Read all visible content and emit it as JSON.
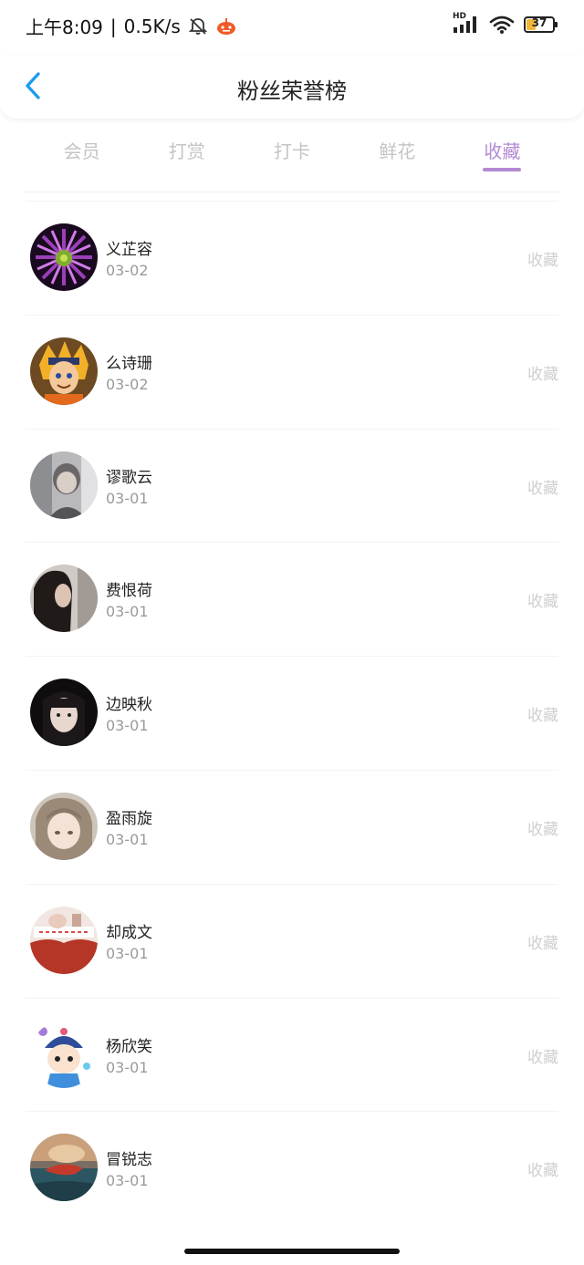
{
  "status_bar": {
    "time": "上午8:09",
    "network_speed": "0.5K/s",
    "hd_label": "HD",
    "battery": "37",
    "battery_level": 0.37,
    "icons": [
      "mute-bell-icon",
      "app-notification-icon",
      "signal-icon",
      "wifi-icon",
      "battery-icon"
    ]
  },
  "header": {
    "title": "粉丝荣誉榜",
    "back_icon": "chevron-left-icon"
  },
  "colors": {
    "accent": "#b38ad3",
    "back_arrow": "#1e9bf0",
    "tab_inactive": "#c4c4c4",
    "action_text": "#cfcfcf",
    "date_text": "#9a9a9a"
  },
  "tabs": [
    {
      "label": "会员",
      "active": false
    },
    {
      "label": "打赏",
      "active": false
    },
    {
      "label": "打卡",
      "active": false
    },
    {
      "label": "鲜花",
      "active": false
    },
    {
      "label": "收藏",
      "active": true
    }
  ],
  "fans": [
    {
      "name": "义芷容",
      "date": "03-02",
      "action": "收藏",
      "avatar": "purple-flower"
    },
    {
      "name": "么诗珊",
      "date": "03-02",
      "action": "收藏",
      "avatar": "anime-boy"
    },
    {
      "name": "谬歌云",
      "date": "03-01",
      "action": "收藏",
      "avatar": "gray-portrait"
    },
    {
      "name": "费恨荷",
      "date": "03-01",
      "action": "收藏",
      "avatar": "dark-hair-girl"
    },
    {
      "name": "边映秋",
      "date": "03-01",
      "action": "收藏",
      "avatar": "girl-selfie"
    },
    {
      "name": "盈雨旋",
      "date": "03-01",
      "action": "收藏",
      "avatar": "anime-girl"
    },
    {
      "name": "却成文",
      "date": "03-01",
      "action": "收藏",
      "avatar": "red-sweater"
    },
    {
      "name": "杨欣笑",
      "date": "03-01",
      "action": "收藏",
      "avatar": "cartoon-kid"
    },
    {
      "name": "冒锐志",
      "date": "03-01",
      "action": "收藏",
      "avatar": "fish-scene"
    }
  ]
}
